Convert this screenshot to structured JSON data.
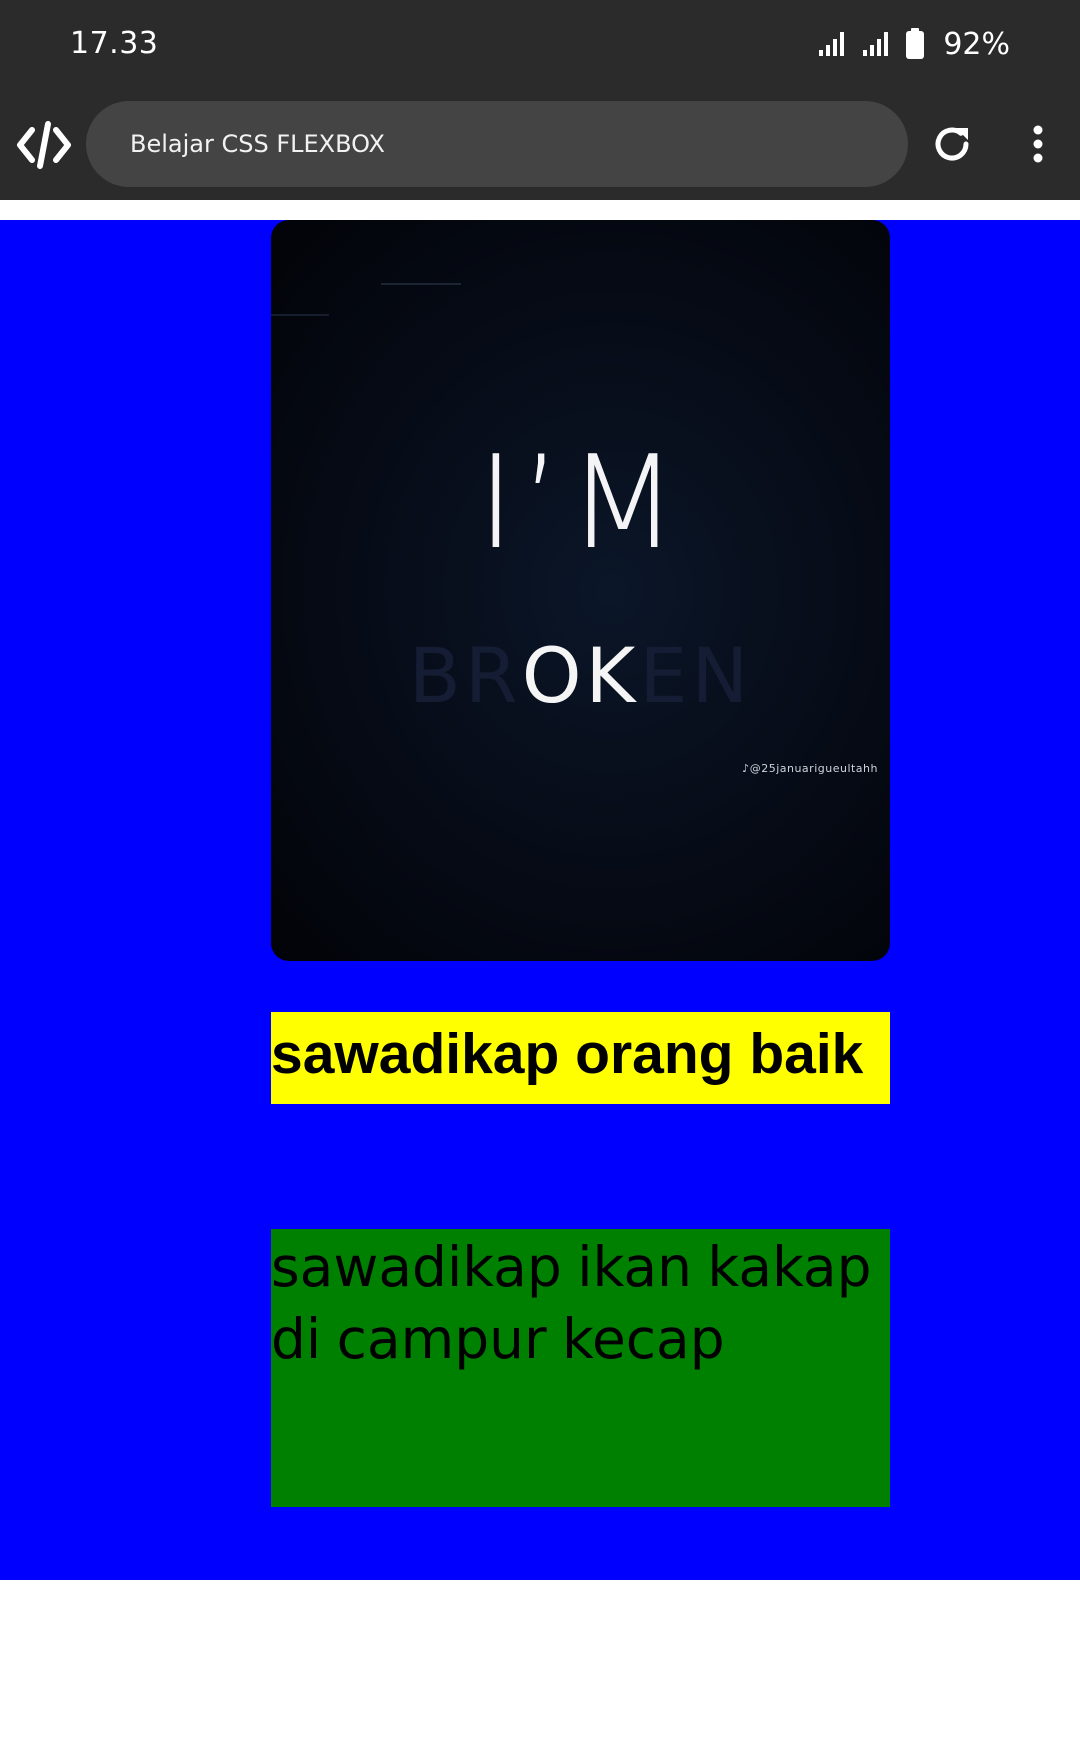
{
  "status_bar": {
    "time": "17.33",
    "battery_percent": "92%",
    "icons": [
      "signal-icon",
      "signal-icon",
      "battery-icon"
    ]
  },
  "browser": {
    "app_icon": "code-brackets-icon",
    "url_bar_text": "Belajar CSS FLEXBOX",
    "reload_icon": "reload-icon",
    "menu_icon": "more-vert-icon"
  },
  "page": {
    "container_color": "#0000ff",
    "image": {
      "line1": "I’M",
      "line2_faint_left": "BR",
      "line2_bright": "OK",
      "line2_faint_right": "EN",
      "watermark": "♪@25januarigueultahh"
    },
    "yellow_box": {
      "text": "sawadikap orang baik",
      "color": "#ffff00"
    },
    "green_box": {
      "text": "sawadikap ikan kakap di campur kecap",
      "color": "#008000"
    }
  }
}
